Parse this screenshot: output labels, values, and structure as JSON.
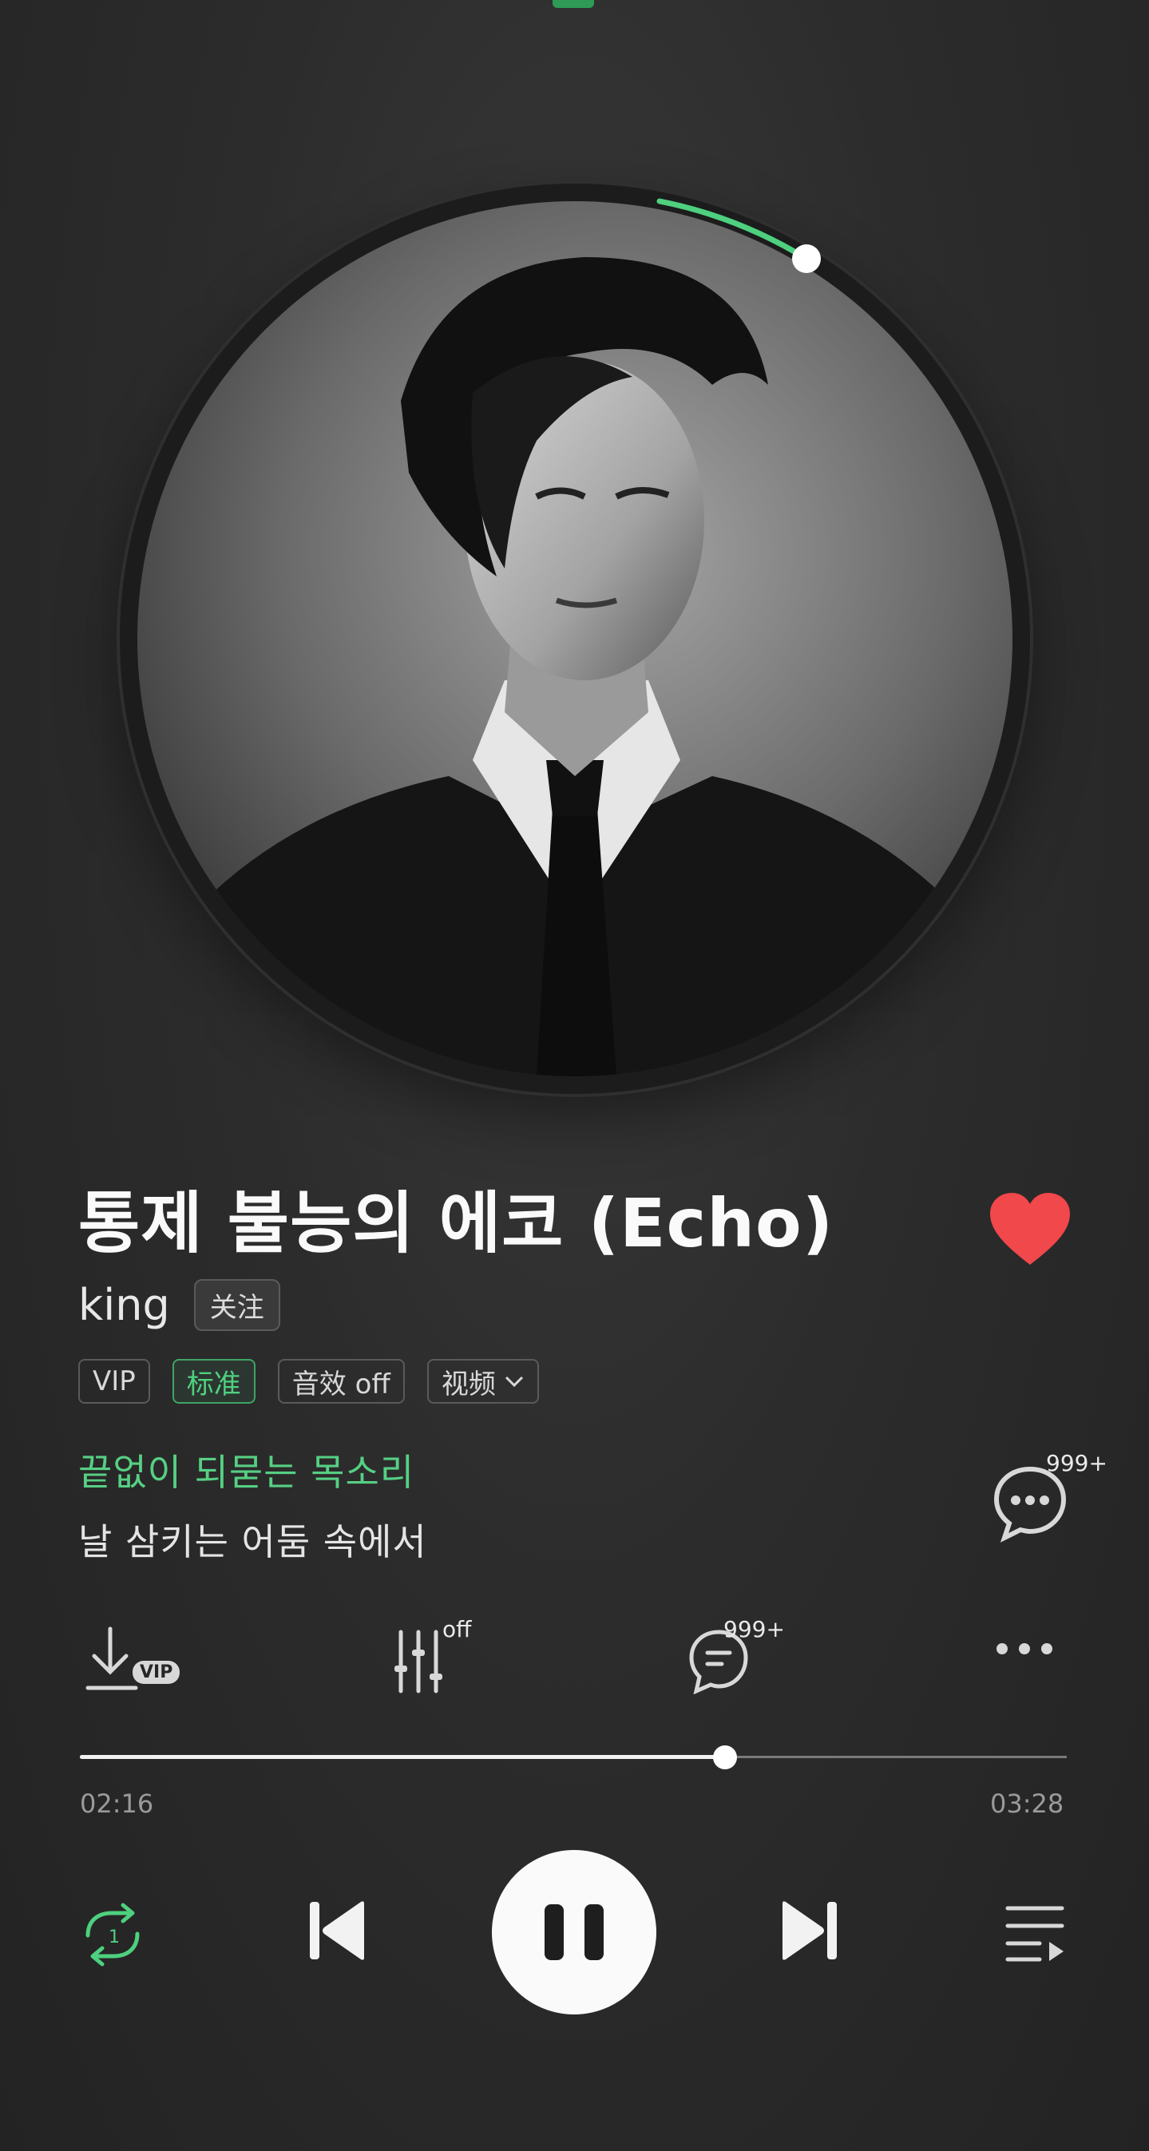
{
  "song": {
    "title": "통제 불능의 에코 (Echo)",
    "artist": "king",
    "follow_label": "关注",
    "liked": true
  },
  "tags": [
    {
      "label": "VIP",
      "active": false
    },
    {
      "label": "标准",
      "active": true
    },
    {
      "label": "音效 off",
      "active": false
    },
    {
      "label": "视频",
      "active": false,
      "has_dropdown": true
    }
  ],
  "lyrics": {
    "current": "끝없이 되묻는 목소리",
    "next": "날 삼키는 어둠 속에서"
  },
  "lyric_comment_badge": "999+",
  "actions": {
    "download_badge": "VIP",
    "equalizer_badge": "off",
    "comments_badge": "999+"
  },
  "playback": {
    "elapsed": "02:16",
    "duration": "03:28",
    "progress": 0.6538,
    "state": "playing",
    "repeat_mode": "repeat-one"
  },
  "colors": {
    "accent_green": "#4ed07f",
    "heart_red": "#f0484b",
    "background": "#2a2a2a"
  },
  "icons": [
    "heart-icon",
    "chevron-down-icon",
    "comment-bubble-icon",
    "download-icon",
    "equalizer-icon",
    "comments-icon",
    "more-icon",
    "repeat-one-icon",
    "previous-icon",
    "pause-icon",
    "next-icon",
    "playlist-icon"
  ]
}
